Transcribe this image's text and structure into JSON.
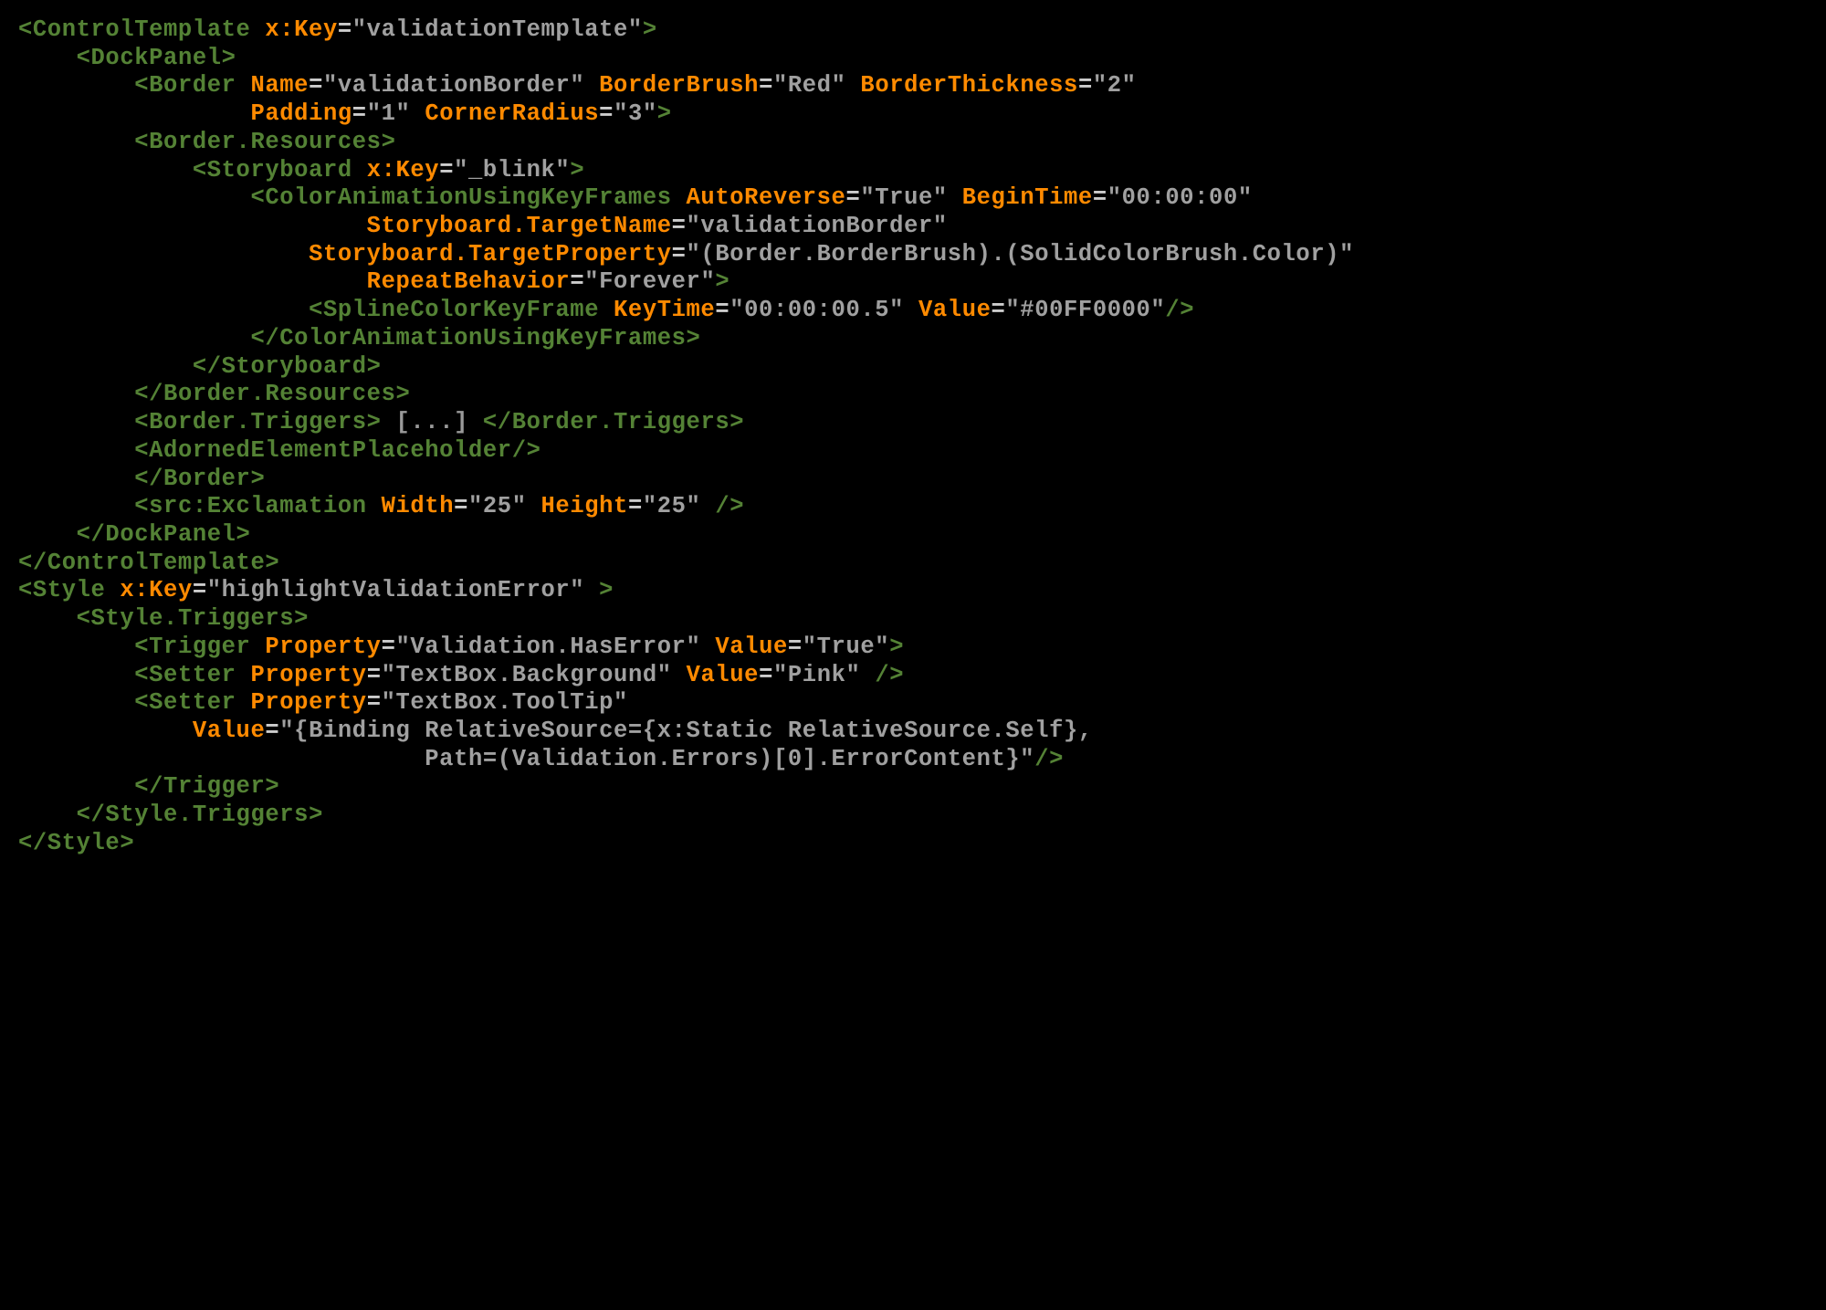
{
  "code": {
    "l01": {
      "t1": "<ControlTemplate ",
      "a1": "x:Key",
      "e": "=",
      "v1": "\"validationTemplate\"",
      "t2": ">"
    },
    "l02": {
      "t1": "<DockPanel>"
    },
    "l03": {
      "t1": "<Border ",
      "a1": "Name",
      "v1": "\"validationBorder\" ",
      "a2": "BorderBrush",
      "v2": "\"Red\" ",
      "a3": "BorderThickness",
      "v3": "\"2\""
    },
    "l04": {
      "a1": "Padding",
      "v1": "\"1\" ",
      "a2": "CornerRadius",
      "v2": "\"3\"",
      "t2": ">"
    },
    "l05": {
      "t1": "<Border.Resources>"
    },
    "l06": {
      "t1": "<Storyboard ",
      "a1": "x:Key",
      "v1": "\"_blink\"",
      "t2": ">"
    },
    "l07": {
      "t1": "<ColorAnimationUsingKeyFrames ",
      "a1": "AutoReverse",
      "v1": "\"True\" ",
      "a2": "BeginTime",
      "v2": "\"00:00:00\""
    },
    "l08": {
      "a1": "Storyboard.TargetName",
      "v1": "\"validationBorder\""
    },
    "l09": {
      "a1": "Storyboard.TargetProperty",
      "v1": "\"(Border.BorderBrush).(SolidColorBrush.Color)\""
    },
    "l10": {
      "a1": "RepeatBehavior",
      "v1": "\"Forever\"",
      "t2": ">"
    },
    "l11": {
      "t1": "<SplineColorKeyFrame ",
      "a1": "KeyTime",
      "v1": "\"00:00:00.5\" ",
      "a2": "Value",
      "v2": "\"#00FF0000\"",
      "t2": "/>"
    },
    "l12": {
      "t1": "</ColorAnimationUsingKeyFrames>"
    },
    "l13": {
      "t1": "</Storyboard>"
    },
    "l14": {
      "t1": "</Border.Resources>"
    },
    "l15": {
      "t1": "<Border.Triggers> ",
      "br": "[...] ",
      "t2": "</Border.Triggers>"
    },
    "l16": {
      "t1": "<AdornedElementPlaceholder/>"
    },
    "l17": {
      "t1": "</Border>"
    },
    "l18": {
      "t1": "<src:Exclamation ",
      "a1": "Width",
      "v1": "\"25\" ",
      "a2": "Height",
      "v2": "\"25\" ",
      "t2": "/>"
    },
    "l19": {
      "t1": "</DockPanel>"
    },
    "l20": {
      "t1": "</ControlTemplate>"
    },
    "l21": {
      "t1": "<Style ",
      "a1": "x:Key",
      "v1": "\"highlightValidationError\" ",
      "t2": ">"
    },
    "l22": {
      "t1": "<Style.Triggers>"
    },
    "l23": {
      "t1": "<Trigger ",
      "a1": "Property",
      "v1": "\"Validation.HasError\" ",
      "a2": "Value",
      "v2": "\"True\"",
      "t2": ">"
    },
    "l24": {
      "t1": "<Setter ",
      "a1": "Property",
      "v1": "\"TextBox.Background\" ",
      "a2": "Value",
      "v2": "\"Pink\" ",
      "t2": "/>"
    },
    "l25": {
      "t1": "<Setter ",
      "a1": "Property",
      "v1": "\"TextBox.ToolTip\""
    },
    "l26": {
      "a1": "Value",
      "v1": "\"{Binding RelativeSource={x:Static RelativeSource.Self},"
    },
    "l27": {
      "v1": "Path=(Validation.Errors)[0].ErrorContent}\"",
      "t2": "/>"
    },
    "l28": {
      "t1": "</Trigger>"
    },
    "l29": {
      "t1": "</Style.Triggers>"
    },
    "l30": {
      "t1": "</Style>"
    }
  },
  "indent": {
    "l01": "",
    "l02": "    ",
    "l03": "        ",
    "l04": "                ",
    "l05": "        ",
    "l06": "            ",
    "l07": "                ",
    "l08": "                        ",
    "l09": "                    ",
    "l10": "                        ",
    "l11": "                    ",
    "l12": "                ",
    "l13": "            ",
    "l14": "        ",
    "l15": "        ",
    "l16": "        ",
    "l17": "        ",
    "l18": "        ",
    "l19": "    ",
    "l20": "",
    "l21": "",
    "l22": "    ",
    "l23": "        ",
    "l24": "        ",
    "l25": "        ",
    "l26": "            ",
    "l27": "                            ",
    "l28": "        ",
    "l29": "    ",
    "l30": ""
  }
}
